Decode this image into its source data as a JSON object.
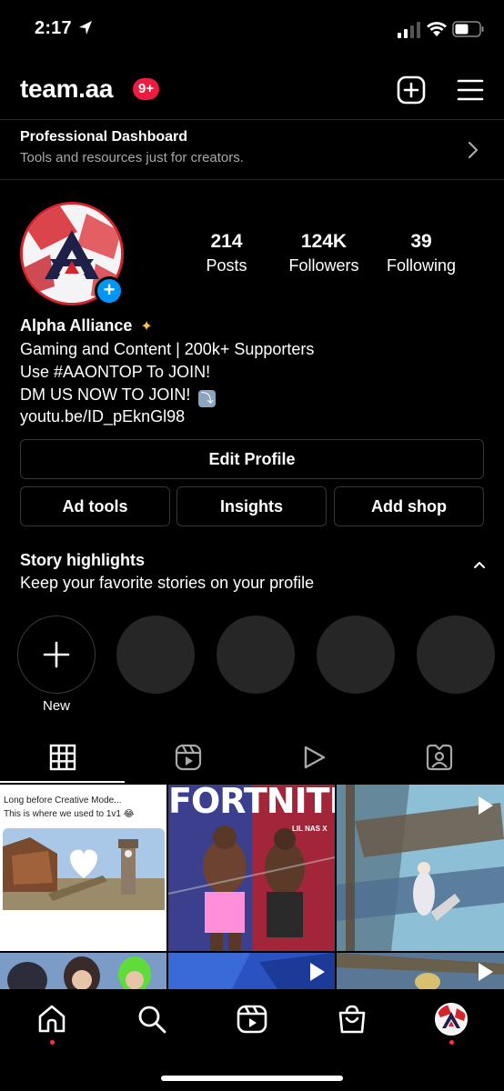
{
  "status_bar": {
    "time": "2:17",
    "icons": [
      "location-arrow-icon",
      "cell-signal-icon",
      "wifi-icon",
      "battery-icon"
    ]
  },
  "header": {
    "username": "team.aa",
    "notification_badge": "9+",
    "badge_color": "#ed1c40",
    "icons": [
      "new-post-icon",
      "hamburger-menu-icon"
    ]
  },
  "professional_dashboard": {
    "title": "Professional Dashboard",
    "subtitle": "Tools and resources just for creators."
  },
  "profile": {
    "stats": [
      {
        "value": "214",
        "label": "Posts"
      },
      {
        "value": "124K",
        "label": "Followers"
      },
      {
        "value": "39",
        "label": "Following"
      }
    ],
    "bio": {
      "name": "Alpha Alliance",
      "line1": "Gaming and Content | 200k+ Supporters",
      "line2": "Use #AAONTOP To JOIN!",
      "line3": "DM US NOW TO JOIN!",
      "link": "youtu.be/ID_pEknGl98"
    },
    "accent_color": "#0095f6"
  },
  "buttons": {
    "edit_profile": "Edit Profile",
    "ad_tools": "Ad tools",
    "insights": "Insights",
    "add_shop": "Add shop"
  },
  "story_highlights": {
    "title": "Story highlights",
    "subtitle": "Keep your favorite stories on your profile",
    "new_label": "New"
  },
  "tabs": [
    "grid-icon",
    "reels-icon",
    "play-icon",
    "tagged-icon"
  ],
  "grid": {
    "post1_caption_line1": "Long before Creative Mode...",
    "post1_caption_line2": "This is where we used to 1v1 😂",
    "post2_title": "FORTNITE",
    "post2_sub": "LIL NAS X"
  },
  "bottom_nav": [
    "home-icon",
    "search-icon",
    "reels-icon",
    "shop-icon",
    "profile-avatar"
  ],
  "notification_dot_color": "#ff3040"
}
